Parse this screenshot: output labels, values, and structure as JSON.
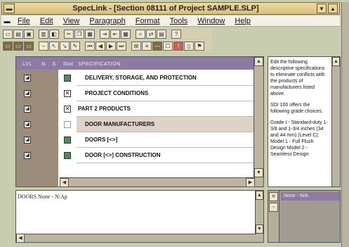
{
  "window": {
    "title": "SpecLink - [Section 08111 of Project SAMPLE.SLP]"
  },
  "menu": [
    "File",
    "Edit",
    "View",
    "Paragraph",
    "Format",
    "Tools",
    "Window",
    "Help"
  ],
  "table": {
    "headers": {
      "lvl": "LVL",
      "n": "N",
      "s": "S",
      "stat": "Stat",
      "spec": "SPECIFICATION"
    },
    "rows": [
      {
        "lvl": "a",
        "stat": "check",
        "text": "DELIVERY, STORAGE, AND PROTECTION",
        "indent": 1
      },
      {
        "lvl": "a",
        "stat": "x",
        "text": "PROJECT CONDITIONS",
        "indent": 1
      },
      {
        "lvl": "a",
        "stat": "x",
        "text": "PART 2  PRODUCTS",
        "indent": 0
      },
      {
        "lvl": "a",
        "stat": "none",
        "text": "DOOR MANUFACTURERS",
        "indent": 1,
        "selected": true
      },
      {
        "lvl": "a",
        "stat": "check",
        "text": "DOORS [<>]",
        "indent": 1
      },
      {
        "lvl": "a",
        "stat": "check",
        "text": "DOOR [<>] CONSTRUCTION",
        "indent": 1
      }
    ]
  },
  "help": {
    "paragraphs": [
      "Edit the following descriptive specifications to eliminate conflicts with the products of manufacturers listed above.",
      "SDI 100 offers the following grade choices:",
      "Grade I - Standard-duty 1-3/8 and 1-3/4 inches (34 and 44 mm) (Level C): Model 1 - Full Flush Design Model 2 - Seamless Design"
    ]
  },
  "notes": {
    "text": "DOORS None - N/Ap"
  },
  "extra": {
    "header": "None - N/A"
  }
}
